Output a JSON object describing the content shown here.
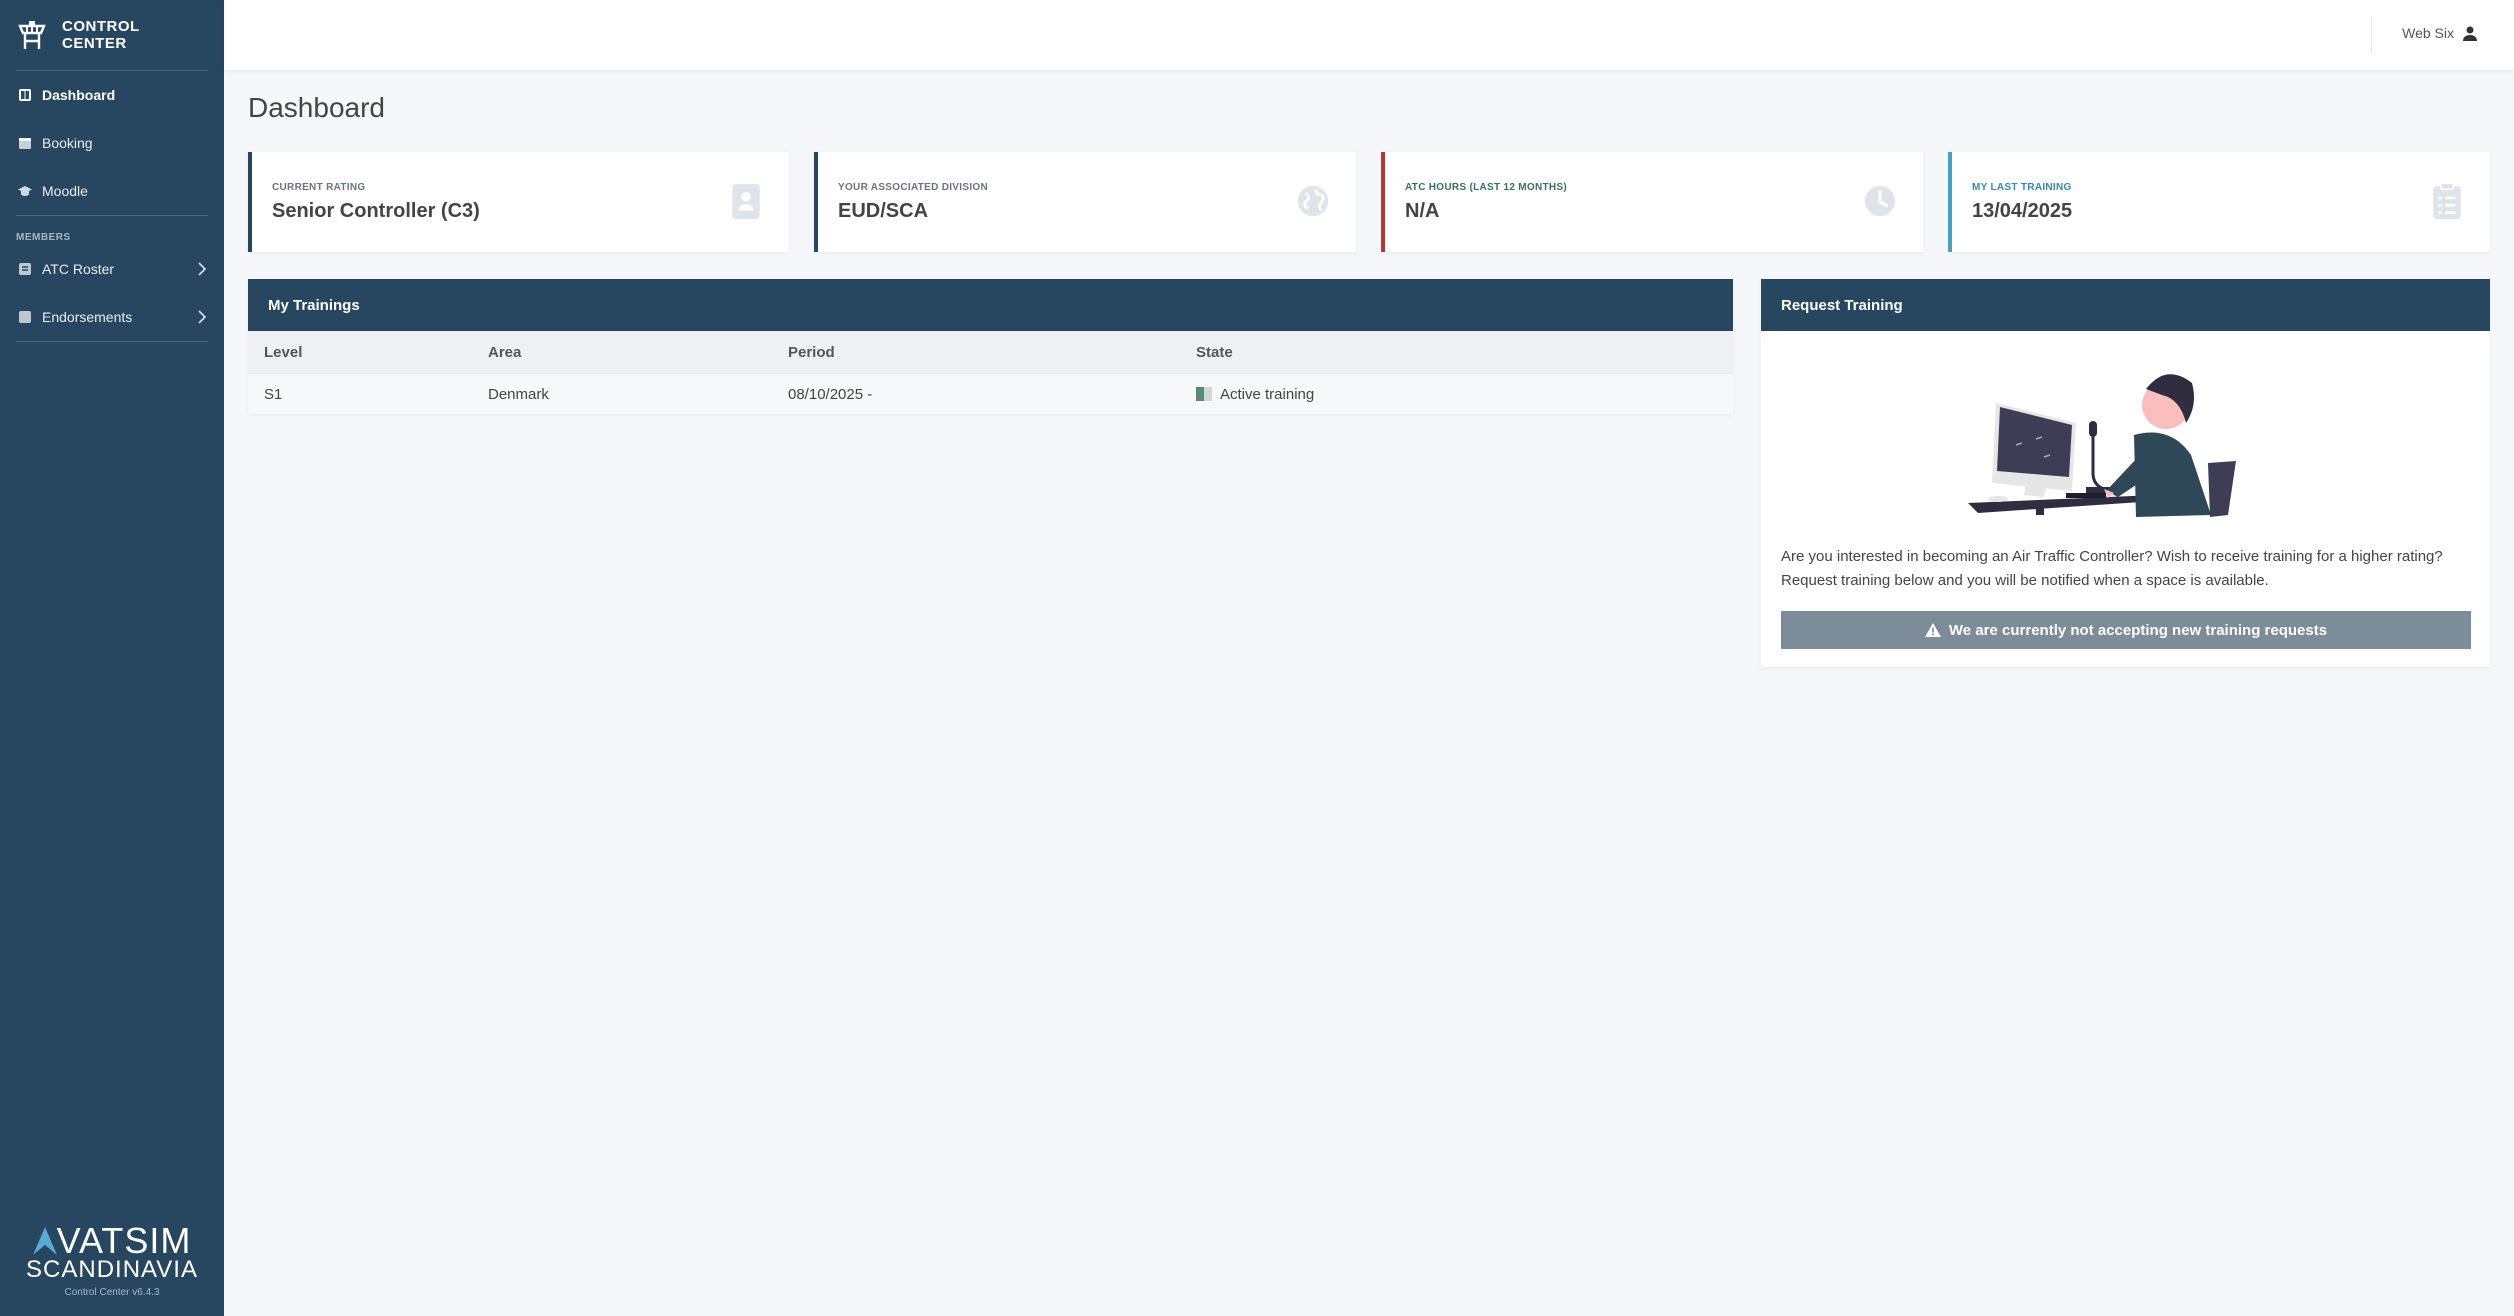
{
  "brand": {
    "line1": "CONTROL",
    "line2": "CENTER"
  },
  "sidebar": {
    "items": [
      {
        "label": "Dashboard",
        "icon": "dashboard-icon"
      },
      {
        "label": "Booking",
        "icon": "calendar-icon"
      },
      {
        "label": "Moodle",
        "icon": "graduation-cap-icon"
      }
    ],
    "members_heading": "MEMBERS",
    "member_items": [
      {
        "label": "ATC Roster",
        "icon": "list-icon"
      },
      {
        "label": "Endorsements",
        "icon": "check-square-icon"
      }
    ],
    "logo_vatsim": "VATSIM",
    "logo_scandinavia": "SCANDINAVIA",
    "version": "Control Center v6.4.3"
  },
  "topbar": {
    "user_name": "Web Six"
  },
  "page_title": "Dashboard",
  "cards": [
    {
      "label": "CURRENT RATING",
      "value": "Senior Controller (C3)",
      "accent": "#27465f",
      "label_color": "#6b7280",
      "icon": "id-badge-icon"
    },
    {
      "label": "YOUR ASSOCIATED DIVISION",
      "value": "EUD/SCA",
      "accent": "#27465f",
      "label_color": "#6b7280",
      "icon": "globe-icon"
    },
    {
      "label": "ATC HOURS (LAST 12 MONTHS)",
      "value": "N/A",
      "accent": "#b03a3a",
      "label_color": "#3a6f5b",
      "icon": "clock-icon"
    },
    {
      "label": "MY LAST TRAINING",
      "value": "13/04/2025",
      "accent": "#4a9fbf",
      "label_color": "#3a87a8",
      "icon": "clipboard-icon"
    }
  ],
  "trainings": {
    "title": "My Trainings",
    "columns": [
      "Level",
      "Area",
      "Period",
      "State"
    ],
    "rows": [
      {
        "level": "S1",
        "area": "Denmark",
        "period": "08/10/2025 -",
        "state": "Active training"
      }
    ]
  },
  "request": {
    "title": "Request Training",
    "text": "Are you interested in becoming an Air Traffic Controller? Wish to receive training for a higher rating? Request training below and you will be notified when a space is available.",
    "notice": "We are currently not accepting new training requests"
  }
}
